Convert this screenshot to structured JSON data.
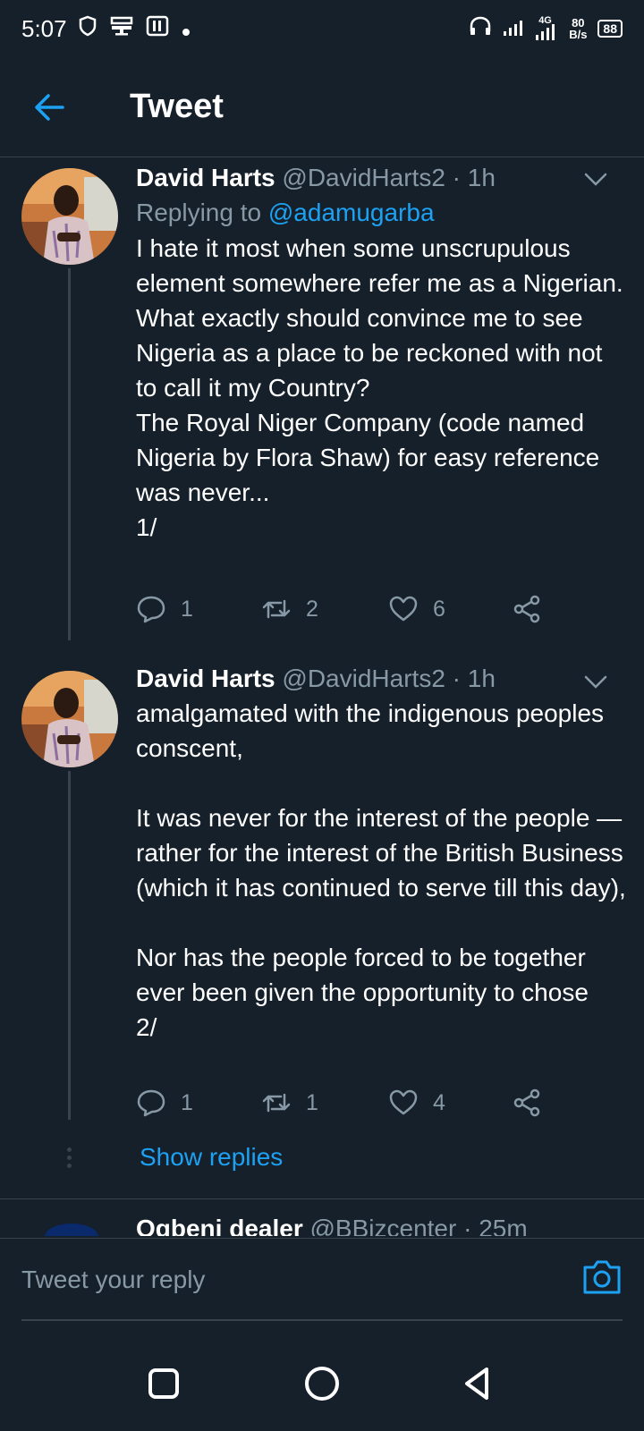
{
  "status_bar": {
    "time": "5:07",
    "network_type": "4G",
    "net_speed_value": "80",
    "net_speed_unit": "B/s",
    "battery": "88"
  },
  "header": {
    "title": "Tweet"
  },
  "tweets": [
    {
      "name": "David Harts",
      "handle": "@DavidHarts2",
      "separator": "·",
      "time": "1h",
      "replying_prefix": "Replying to",
      "replying_to": "@adamugarba",
      "text": "I hate it most when some unscrupulous element somewhere refer me as a Nigerian.\nWhat exactly should convince me to see Nigeria as a place to be reckoned with not to call it my Country?\nThe Royal Niger Company (code named Nigeria by Flora Shaw) for easy reference was never...\n1/",
      "replies": "1",
      "retweets": "2",
      "likes": "6"
    },
    {
      "name": "David Harts",
      "handle": "@DavidHarts2",
      "separator": "·",
      "time": "1h",
      "text": "amalgamated with the indigenous peoples conscent,\n\nIt was never for the interest of the people — rather for the interest of the British Business (which it has continued to serve till this day),\n\nNor has the people forced to be together ever been given the opportunity to chose\n2/",
      "replies": "1",
      "retweets": "1",
      "likes": "4"
    }
  ],
  "show_replies": "Show replies",
  "next_tweet_peek": {
    "name": "Ogbeni dealer",
    "handle": "@BBizcenter · 25m"
  },
  "reply_bar": {
    "placeholder": "Tweet your reply"
  },
  "colors": {
    "background": "#15202b",
    "accent": "#1da1f2",
    "secondary_text": "#8899a6",
    "divider": "#38444d"
  },
  "icons": {
    "back": "arrow-left-icon",
    "reply": "speech-bubble-icon",
    "retweet": "retweet-icon",
    "like": "heart-icon",
    "share": "share-icon",
    "camera": "camera-icon"
  }
}
